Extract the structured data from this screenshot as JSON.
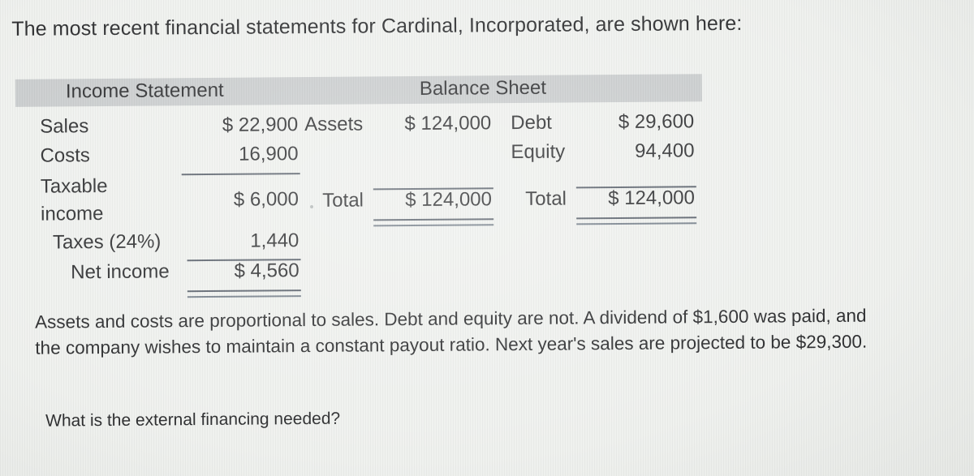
{
  "intro": "The most recent financial statements for Cardinal, Incorporated, are shown here:",
  "tables": {
    "income_statement": {
      "title": "Income Statement",
      "rows": [
        {
          "label": "Sales",
          "value": "$ 22,900"
        },
        {
          "label": "Costs",
          "value": "16,900"
        },
        {
          "label": "Taxable",
          "label2": "income",
          "value": "$ 6,000"
        },
        {
          "label": "Taxes (24%)",
          "value": "1,440"
        },
        {
          "label": "Net income",
          "value": "$ 4,560"
        }
      ]
    },
    "balance_sheet": {
      "title": "Balance Sheet",
      "assets_side": [
        {
          "label": "Assets",
          "value": "$ 124,000"
        },
        {
          "label": "Total",
          "value": "$ 124,000"
        }
      ],
      "liabilities_side": [
        {
          "label": "Debt",
          "value": "$ 29,600"
        },
        {
          "label": "Equity",
          "value": "94,400"
        },
        {
          "label": "Total",
          "value": "$ 124,000"
        }
      ]
    }
  },
  "prose": "Assets and costs are proportional to sales. Debt and equity are not. A dividend of $1,600 was paid, and the company wishes to maintain a constant payout ratio. Next year's sales are projected to be $29,300.",
  "question": "What is the external financing needed?",
  "colors": {
    "page_background": "#eef0ed",
    "header_band": "#c6c9ca",
    "text": "#1b1c1e",
    "rule": "#4d5560"
  }
}
